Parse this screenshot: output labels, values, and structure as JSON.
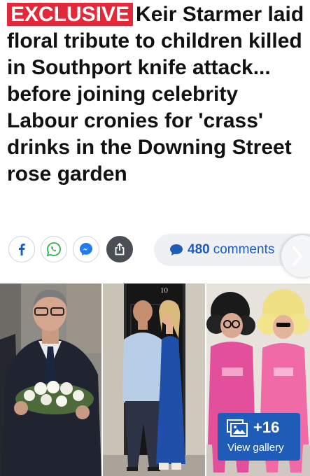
{
  "article": {
    "tag": "EXCLUSIVE",
    "headline": "Keir Starmer laid floral tribute to children killed in Southport knife attack... before joining celebrity Labour cronies for 'crass' drinks in the Downing Street rose garden"
  },
  "share": {
    "icons": [
      "facebook-icon",
      "whatsapp-icon",
      "messenger-icon",
      "share-icon"
    ],
    "comment_count": "480",
    "comment_label": "comments"
  },
  "gallery": {
    "door_number": "10",
    "extra_count": "+16",
    "view_label": "View gallery"
  },
  "colors": {
    "tag": "#e3283a",
    "accent_blue": "#1f5cb8",
    "facebook": "#1f5cb8",
    "whatsapp": "#2fb344",
    "messenger": "#1e7bf2",
    "share": "#4a4f55"
  }
}
